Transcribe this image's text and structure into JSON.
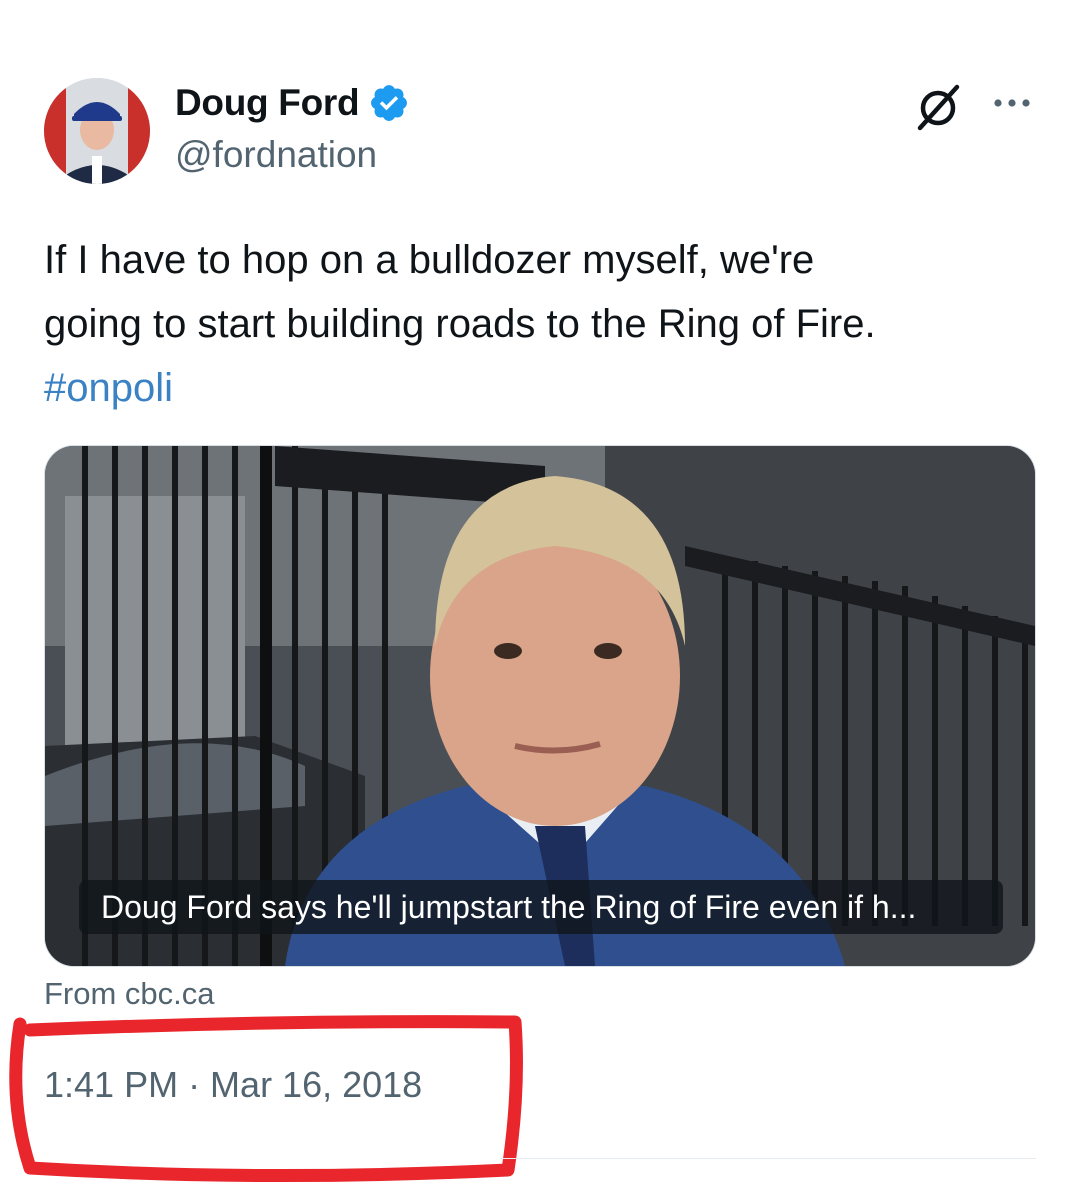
{
  "tweet": {
    "display_name": "Doug Ford",
    "handle": "@fordnation",
    "verified_icon": "verified-badge-icon",
    "text_lines": [
      "If I have to hop on a bulldozer myself, we're",
      "going to start building roads to the Ring of Fire."
    ],
    "hashtag": "#onpoli",
    "media": {
      "caption": "Doug Ford says he'll jumpstart the Ring of Fire even if h...",
      "source": "From cbc.ca"
    },
    "timestamp": "1:41 PM · Mar 16, 2018"
  },
  "header_icons": {
    "grok": "grok-icon",
    "more": "more-icon"
  },
  "colors": {
    "text_primary": "#0f1419",
    "text_secondary": "#536471",
    "link": "#3b82c4",
    "verified": "#1d9bf0",
    "highlight_marker": "#e8262c"
  }
}
